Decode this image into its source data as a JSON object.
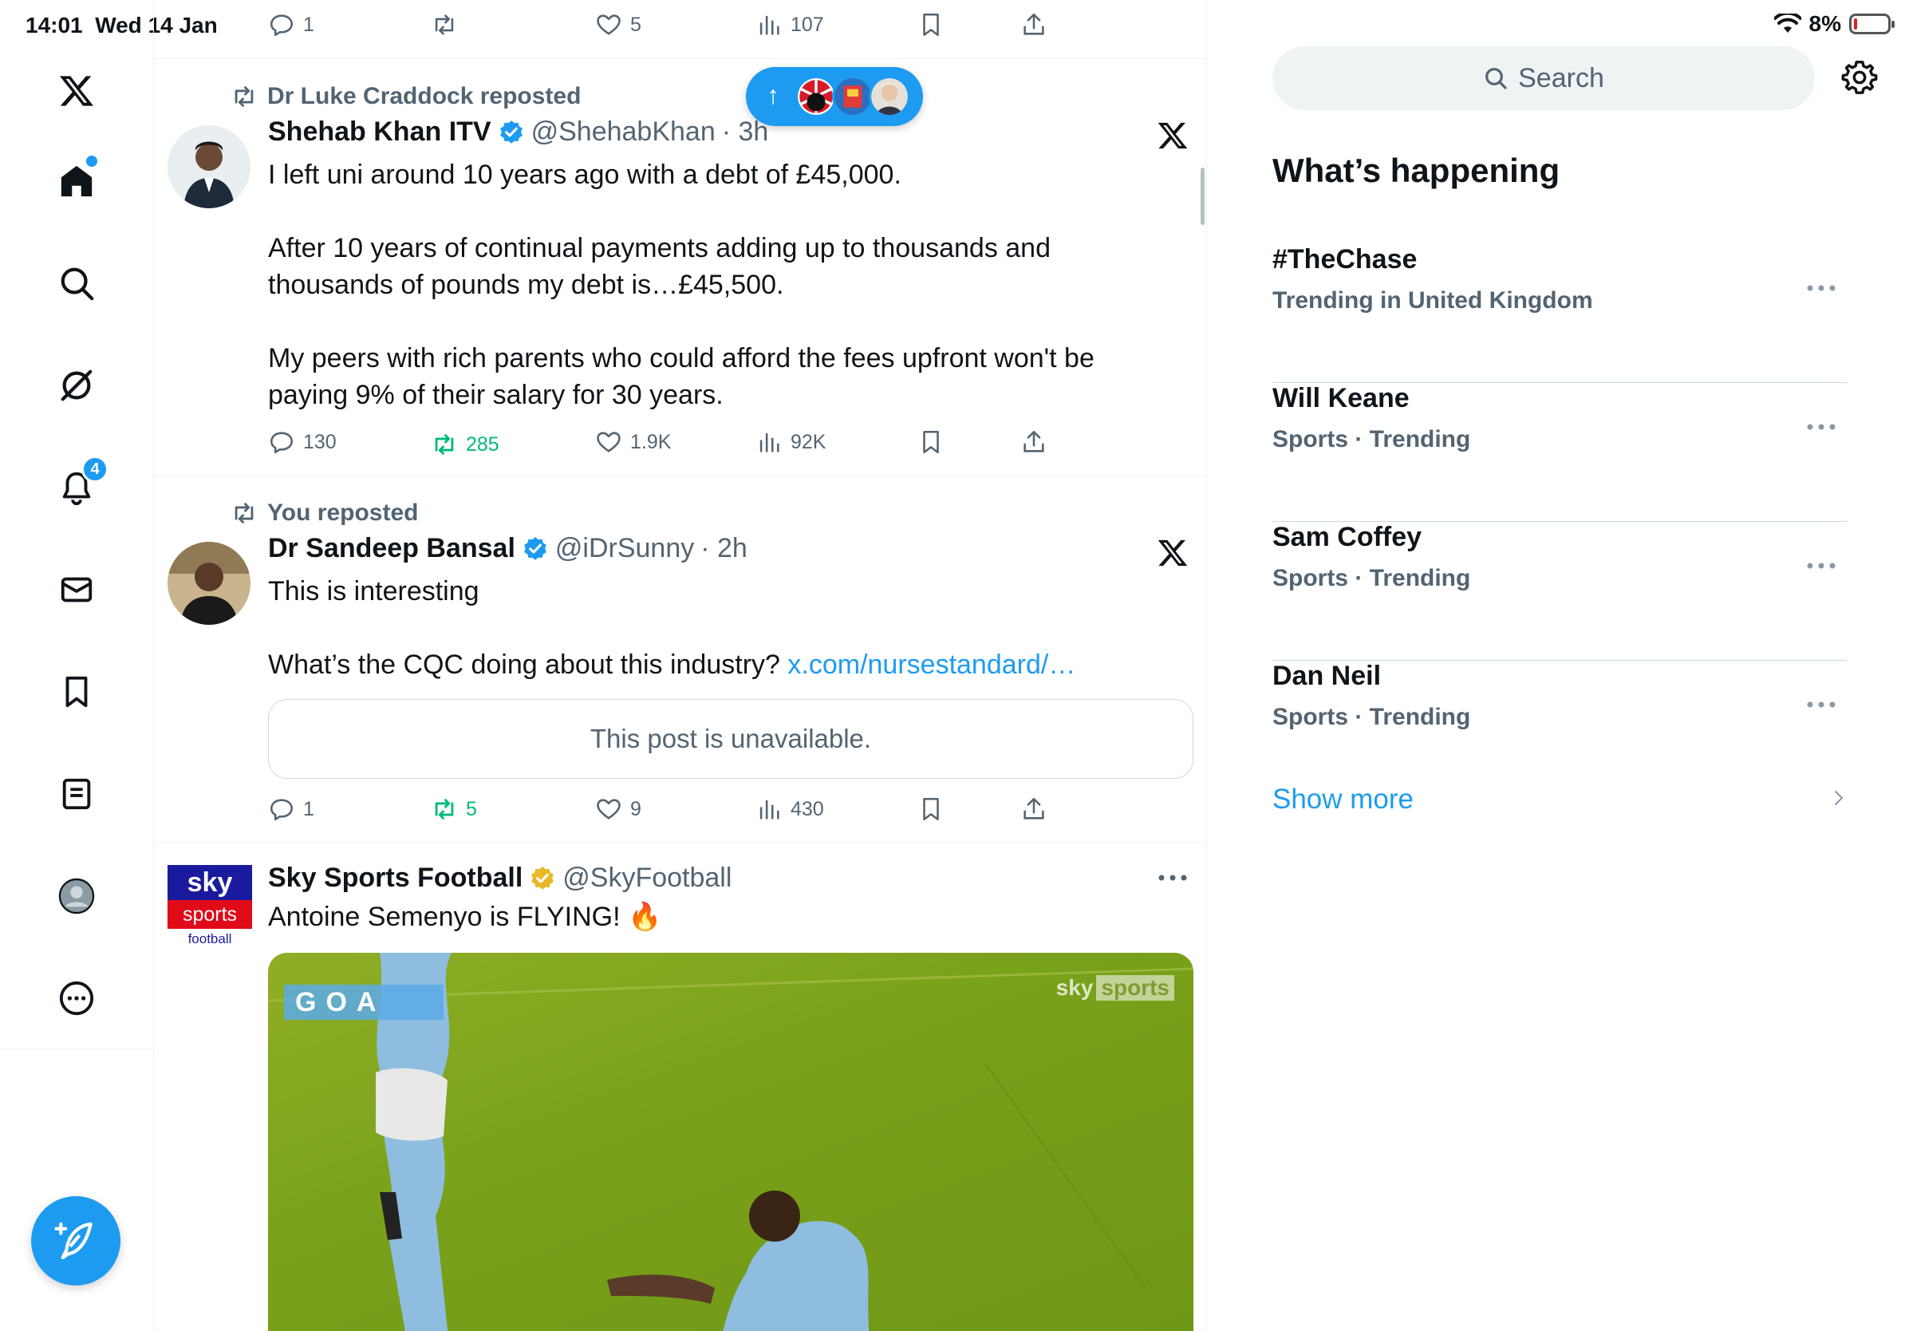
{
  "status_bar": {
    "time": "14:01",
    "date": "Wed 14 Jan",
    "battery": "8%"
  },
  "nav": {
    "items": [
      "x-logo",
      "home",
      "explore",
      "grok",
      "notifications",
      "messages",
      "bookmarks",
      "lists",
      "profile",
      "more"
    ],
    "notifications_badge": "4",
    "compose_label": "Post"
  },
  "timeline": {
    "top_actions": {
      "replies": "1",
      "likes": "5",
      "views": "107"
    },
    "jump_pill": {
      "arrow": "↑"
    },
    "posts": [
      {
        "context": "Dr Luke Craddock reposted",
        "name": "Shehab Khan ITV",
        "handle": "@ShehabKhan",
        "time": "· 3h",
        "text": [
          "I left uni around 10 years ago with a debt of £45,000.",
          "After 10 years of continual payments adding up to thousands and",
          "thousands of pounds my debt is…£45,500.",
          "My peers with rich parents who could afford the fees upfront won't be",
          "paying 9% of their salary for 30 years."
        ],
        "actions": {
          "replies": "130",
          "reposts": "285",
          "likes": "1.9K",
          "views": "92K"
        }
      },
      {
        "context": "You reposted",
        "name": "Dr Sandeep Bansal",
        "handle": "@iDrSunny",
        "time": "· 2h",
        "text": [
          "This is interesting",
          "What’s the CQC doing about this industry?"
        ],
        "link": "x.com/nursestandard/…",
        "unavailable": "This post is unavailable.",
        "actions": {
          "replies": "1",
          "reposts": "5",
          "likes": "9",
          "views": "430"
        }
      },
      {
        "name": "Sky Sports Football",
        "handle": "@SkyFootball",
        "text": [
          "Antoine Semenyo is FLYING! 🔥"
        ],
        "avatar_text": {
          "sky": "sky",
          "sports": "sports",
          "football": "football"
        },
        "media_overlay": "GOA",
        "media_brand": [
          "sky",
          "sports"
        ]
      }
    ]
  },
  "sidebar": {
    "search_placeholder": "Search",
    "title": "What’s happening",
    "trends": [
      {
        "name": "#TheChase",
        "sub": "Trending in United Kingdom"
      },
      {
        "name": "Will Keane",
        "sub": "Sports · Trending"
      },
      {
        "name": "Sam Coffey",
        "sub": "Sports · Trending"
      },
      {
        "name": "Dan Neil",
        "sub": "Sports · Trending"
      }
    ],
    "show_more": "Show more"
  },
  "colors": {
    "accent": "#1d9bf0",
    "repost_green": "#00ba7c",
    "secondary_text": "#536471",
    "verified_gold": "#e8b829"
  }
}
